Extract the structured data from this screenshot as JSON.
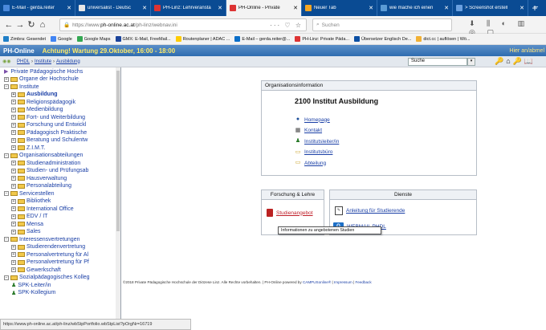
{
  "browser": {
    "tabs": [
      {
        "label": "E-Mail - gerda.reiter",
        "icon_color": "#4a89dc",
        "active": false
      },
      {
        "label": "universalist - Deutsc",
        "icon_color": "#e6e6e6",
        "active": false
      },
      {
        "label": "PH-Linz: Lehrveransta",
        "icon_color": "#d33",
        "active": false
      },
      {
        "label": "PH-Online - Private",
        "icon_color": "#d33",
        "active": true
      },
      {
        "label": "Neuer Tab",
        "icon_color": "#f5a623",
        "active": false
      },
      {
        "label": "wie mache ich einen",
        "icon_color": "#5b9bd5",
        "active": false
      },
      {
        "label": "> Screenshot erstell",
        "icon_color": "#6aa0e0",
        "active": false
      }
    ],
    "new_tab": "+",
    "minimize": "–",
    "url_secure_prefix": "https://www.",
    "url_domain": "ph-online.ac.at",
    "url_path": "/ph-linz/webnav.ini",
    "url_actions": "··· ♡ ☆",
    "search_placeholder": "Suchen",
    "nav_icons": "⬇ ⫼ ◐ ▥ ◎ ▢"
  },
  "bookmarks": [
    {
      "label": "Zimbra: Gesendet",
      "icon_color": "#1f7fc7"
    },
    {
      "label": "Google",
      "icon_color": "#4285f4"
    },
    {
      "label": "Google Maps",
      "icon_color": "#34a853"
    },
    {
      "label": "GMX: E-Mail, FreeMail...",
      "icon_color": "#1c449b"
    },
    {
      "label": "Routenplaner | ADAC ...",
      "icon_color": "#ffcc00"
    },
    {
      "label": "E-Mail – gerda.reiter@...",
      "icon_color": "#0a6ec8"
    },
    {
      "label": "PH-Linz: Private Päda...",
      "icon_color": "#d33"
    },
    {
      "label": "Übersetzer Englisch De...",
      "icon_color": "#0b4fa3"
    },
    {
      "label": "dict.cc | auflösen | Wö...",
      "icon_color": "#f2b134"
    }
  ],
  "ph_header": {
    "logo": "PH-Online",
    "warning": "Achtung! Wartung 29.Oktober, 16:00 - 18:00",
    "right_text": "Hier an/abmel"
  },
  "crumbs": {
    "icons": "◉◉",
    "items": [
      "PHDL",
      "Institute",
      "Ausbildung"
    ],
    "search_label": "Suche",
    "tool_icons": "🔑⌂🔑📖"
  },
  "sidebar": {
    "root": "Private Pädagogische Hochs",
    "nodes": [
      {
        "label": "Organe der Hochschule",
        "level": 0,
        "toggle": "+",
        "bold": false
      },
      {
        "label": "Institute",
        "level": 0,
        "toggle": "−",
        "bold": false
      },
      {
        "label": "Ausbildung",
        "level": 1,
        "toggle": "+",
        "bold": true
      },
      {
        "label": "Religionspädagogik",
        "level": 1,
        "toggle": "+",
        "bold": false
      },
      {
        "label": "Medienbildung",
        "level": 1,
        "toggle": "+",
        "bold": false
      },
      {
        "label": "Fort- und Weiterbildung",
        "level": 1,
        "toggle": "+",
        "bold": false
      },
      {
        "label": "Forschung und Entwickl",
        "level": 1,
        "toggle": "+",
        "bold": false
      },
      {
        "label": "Pädagogisch Praktische",
        "level": 1,
        "toggle": "+",
        "bold": false
      },
      {
        "label": "Beratung und Schulentw",
        "level": 1,
        "toggle": "+",
        "bold": false
      },
      {
        "label": "Z.I.M.T.",
        "level": 1,
        "toggle": "+",
        "bold": false
      },
      {
        "label": "Organisationsabteilungen",
        "level": 0,
        "toggle": "−",
        "bold": false
      },
      {
        "label": "Studienadministration",
        "level": 1,
        "toggle": "+",
        "bold": false
      },
      {
        "label": "Studien- und Prüfungsab",
        "level": 1,
        "toggle": "+",
        "bold": false
      },
      {
        "label": "Hausverwaltung",
        "level": 1,
        "toggle": "+",
        "bold": false
      },
      {
        "label": "Personalabteilung",
        "level": 1,
        "toggle": "+",
        "bold": false
      },
      {
        "label": "Servicestellen",
        "level": 0,
        "toggle": "−",
        "bold": false
      },
      {
        "label": "Bibliothek",
        "level": 1,
        "toggle": "+",
        "bold": false
      },
      {
        "label": "International Office",
        "level": 1,
        "toggle": "+",
        "bold": false
      },
      {
        "label": "EDV / IT",
        "level": 1,
        "toggle": "+",
        "bold": false
      },
      {
        "label": "Mensa",
        "level": 1,
        "toggle": "+",
        "bold": false
      },
      {
        "label": "Sales",
        "level": 1,
        "toggle": "+",
        "bold": false
      },
      {
        "label": "Interessensvertretungen",
        "level": 0,
        "toggle": "−",
        "bold": false
      },
      {
        "label": "Studierendenvertretung",
        "level": 1,
        "toggle": "+",
        "bold": false
      },
      {
        "label": "Personalvertretung für Al",
        "level": 1,
        "toggle": "+",
        "bold": false
      },
      {
        "label": "Personalvertretung für Pf",
        "level": 1,
        "toggle": "+",
        "bold": false
      },
      {
        "label": "Gewerkschaft",
        "level": 1,
        "toggle": "+",
        "bold": false
      },
      {
        "label": "Sozialpädagogisches Kolleg",
        "level": 0,
        "toggle": "−",
        "bold": false
      },
      {
        "label": "SPK-Leiter/in",
        "level": 1,
        "toggle": "",
        "bold": false,
        "person": true
      },
      {
        "label": "SPK-Kollegium",
        "level": 1,
        "toggle": "",
        "bold": false,
        "person": true
      }
    ]
  },
  "org_info": {
    "heading": "Organisationsinformation",
    "title": "2100 Institut Ausbildung",
    "links": [
      {
        "label": "Homepage",
        "icon": "●",
        "icon_color": "#1d4f9a"
      },
      {
        "label": "Kontakt",
        "icon": "▦",
        "icon_color": "#444"
      },
      {
        "label": "Institutsleiter/in",
        "icon": "♟",
        "icon_color": "#2a7a2a"
      },
      {
        "label": "Institutsbüro",
        "icon": "▭",
        "icon_color": "#c9a227"
      },
      {
        "label": "Abteilung",
        "icon": "▭",
        "icon_color": "#c9a227"
      }
    ]
  },
  "forschung": {
    "heading": "Forschung & Lehre",
    "link": "Studienangebot"
  },
  "dienste": {
    "heading": "Dienste",
    "link1": "Anleitung für Studierende",
    "link2": "WEBMAIL PHDL",
    "mail_icon_text": "O"
  },
  "tooltip": "Informationen zu angebotenen Studien",
  "footer": {
    "text": "©2018 Private Pädagogische Hochschule der Diözese Linz. Alle Rechte vorbehalten. | PH-Online powered by ",
    "link1": "CAMPUSonline®",
    "sep1": " | ",
    "link2": "Impressum",
    "sep2": " | ",
    "link3": "Feedback"
  },
  "status_url": "https://www.ph-online.ac.at/ph-linz/wbStpPortfolio.wbStpList?pOrgNr=16719"
}
